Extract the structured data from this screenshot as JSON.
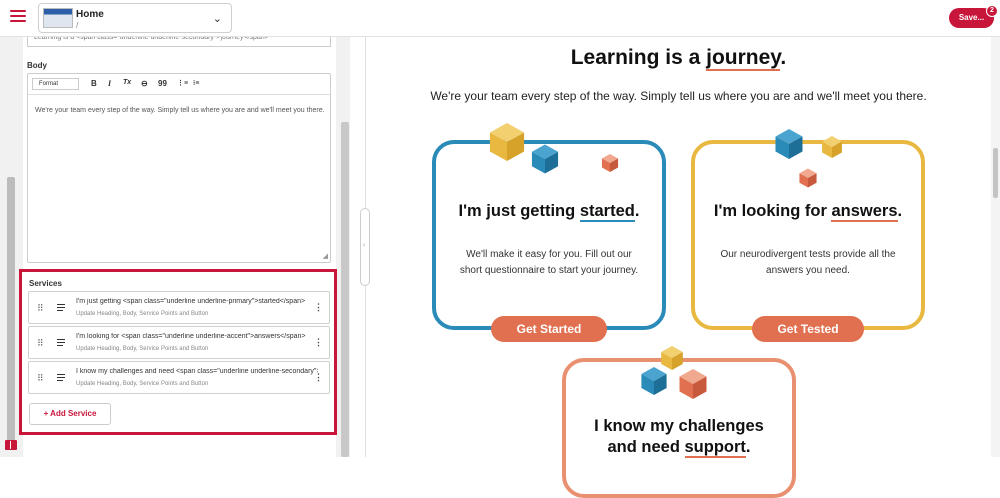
{
  "topbar": {
    "page_name": "Home",
    "page_slug": "/",
    "save_label": "Save...",
    "save_badge": "2"
  },
  "editor": {
    "cut_field_text": "Learning is a <span class=\"underline underline-secondary\">journey</span>",
    "body_label": "Body",
    "format_label": "Format",
    "toolbar": {
      "bold": "B",
      "italic": "I",
      "clear": "Tx",
      "link": "⊖",
      "quote": "99"
    },
    "body_text": "We're your team every step of the way. Simply tell us where you are and we'll meet you there."
  },
  "services": {
    "label": "Services",
    "items": [
      {
        "title": "I'm just getting <span class=\"underline underline-primary\">started</span>",
        "subtitle": "Update Heading, Body, Service Points and Button"
      },
      {
        "title": "I'm looking for <span class=\"underline underline-accent\">answers</span>",
        "subtitle": "Update Heading, Body, Service Points and Button"
      },
      {
        "title": "I know my challenges and need <span class=\"underline underline-secondary\">support</span>",
        "subtitle": "Update Heading, Body, Service Points and Button"
      }
    ],
    "add_label": "Add Service"
  },
  "preview": {
    "heading_pre": "Learning is a ",
    "heading_word": "journey",
    "heading_post": ".",
    "subheading": "We're your team every step of the way. Simply tell us where you are and we'll meet you there.",
    "cards": [
      {
        "title_pre": "I'm just getting ",
        "title_word": "started",
        "title_post": ".",
        "body": "We'll make it easy for you. Fill out our short questionnaire to start your journey.",
        "button": "Get Started"
      },
      {
        "title_pre": "I'm looking for ",
        "title_word": "answers",
        "title_post": ".",
        "body": "Our neurodivergent tests provide all the answers you need.",
        "button": "Get Tested"
      },
      {
        "title_line1": "I know my challenges",
        "title_pre": "and need ",
        "title_word": "support",
        "title_post": "."
      }
    ]
  },
  "colors": {
    "brand": "#c8163b",
    "blue": "#2a8ab8",
    "yellow": "#e8b840",
    "coral": "#e07050"
  }
}
